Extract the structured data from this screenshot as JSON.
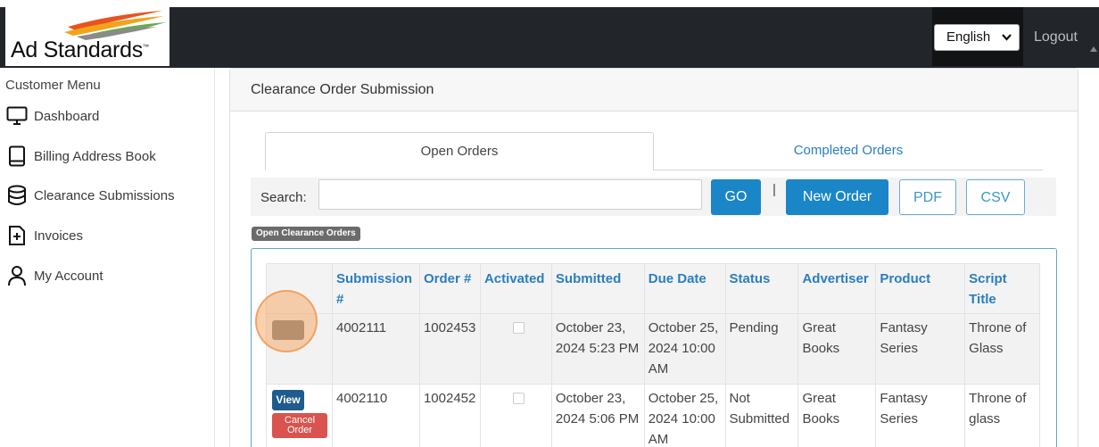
{
  "header": {
    "logo": {
      "text": "Ad Standards",
      "tm": "™"
    },
    "language": {
      "selected": "English"
    },
    "logout_label": "Logout"
  },
  "sidebar": {
    "title": "Customer Menu",
    "items": [
      {
        "label": "Dashboard",
        "icon": "monitor-icon"
      },
      {
        "label": "Billing Address Book",
        "icon": "book-icon"
      },
      {
        "label": "Clearance Submissions",
        "icon": "database-icon"
      },
      {
        "label": "Invoices",
        "icon": "file-plus-icon"
      },
      {
        "label": "My Account",
        "icon": "user-icon"
      }
    ]
  },
  "card": {
    "title": "Clearance Order Submission",
    "tabs": {
      "open": "Open Orders",
      "completed": "Completed Orders"
    },
    "search": {
      "label": "Search:",
      "value": "",
      "placeholder": ""
    },
    "buttons": {
      "go": "GO",
      "separator": "|",
      "new_order": "New Order",
      "pdf": "PDF",
      "csv": "CSV"
    },
    "badge": "Open Clearance Orders"
  },
  "table": {
    "headers": [
      "",
      "Submission #",
      "Order #",
      "Activated",
      "Submitted",
      "Due Date",
      "Status",
      "Advertiser",
      "Product",
      "Script Title"
    ],
    "rows": [
      {
        "submission": "4002111",
        "order": "1002453",
        "activated": false,
        "submitted": "October 23, 2024 5:23 PM",
        "due_date": "October 25, 2024 10:00 AM",
        "status": "Pending",
        "advertiser": "Great Books",
        "product": "Fantasy Series",
        "script_title": "Throne of Glass"
      },
      {
        "submission": "4002110",
        "order": "1002452",
        "activated": false,
        "submitted": "October 23, 2024 5:06 PM",
        "due_date": "October 25, 2024 10:00 AM",
        "status": "Not Submitted",
        "advertiser": "Great Books",
        "product": "Fantasy Series",
        "script_title": "Throne of glass",
        "actions": {
          "view": "View",
          "cancel": "Cancel Order"
        }
      }
    ]
  },
  "colors": {
    "accent": "#1a86c7",
    "header_bg": "#22262b",
    "danger": "#d9534f",
    "dark_blue": "#1f5c8d"
  }
}
